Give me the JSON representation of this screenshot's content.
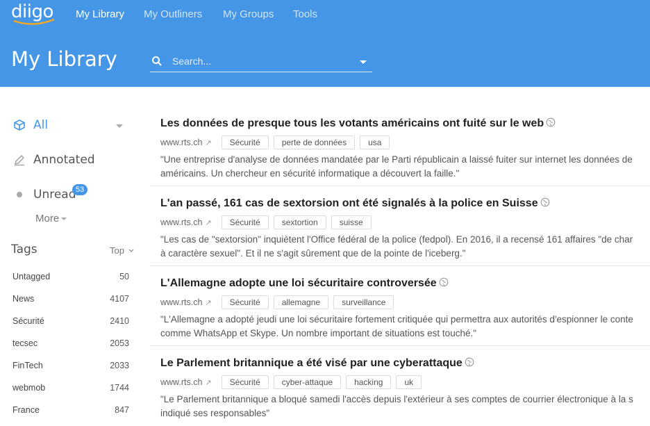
{
  "app": {
    "logo": "diigo",
    "brand_color": "#4596e6"
  },
  "nav": {
    "items": [
      "My Library",
      "My Outliners",
      "My Groups",
      "Tools"
    ],
    "active": "My Library"
  },
  "header": {
    "title": "My Library",
    "search_placeholder": "Search..."
  },
  "sidebar": {
    "filters": [
      {
        "label": "All",
        "icon": "cube-icon",
        "active": true
      },
      {
        "label": "Annotated",
        "icon": "pencil-icon"
      },
      {
        "label": "Unread",
        "icon": "dot-icon",
        "badge": "53"
      }
    ],
    "more_label": "More",
    "tags_heading": "Tags",
    "tags_sort": "Top",
    "tags": [
      {
        "name": "Untagged",
        "count": "50"
      },
      {
        "name": "News",
        "count": "4107"
      },
      {
        "name": "Sécurité",
        "count": "2410"
      },
      {
        "name": "tecsec",
        "count": "2053"
      },
      {
        "name": "FinTech",
        "count": "2033"
      },
      {
        "name": "webmob",
        "count": "1744"
      },
      {
        "name": "France",
        "count": "847"
      }
    ]
  },
  "items": [
    {
      "title": "Les données de presque tous les votants américains ont fuité sur le web",
      "domain": "www.rts.ch",
      "tags": [
        "Sécurité",
        "perte de données",
        "usa"
      ],
      "desc1": "\"Une entreprise d'analyse de données mandatée par le Parti républicain a laissé fuiter sur internet les données de",
      "desc2": "américains. Un chercheur en sécurité informatique a découvert la faille.\""
    },
    {
      "title": "L'an passé, 161 cas de sextorsion ont été signalés à la police en Suisse",
      "domain": "www.rts.ch",
      "tags": [
        "Sécurité",
        "sextortion",
        "suisse"
      ],
      "desc1": "\"Les cas de \"sextorsion\" inquiètent l'Office fédéral de la police (fedpol). En 2016, il a recensé 161 affaires \"de char",
      "desc2": "à caractère sexuel\". Et il ne s'agit sûrement que de la pointe de l'iceberg.\""
    },
    {
      "title": "L'Allemagne adopte une loi sécuritaire controversée",
      "domain": "www.rts.ch",
      "tags": [
        "Sécurité",
        "allemagne",
        "surveillance"
      ],
      "desc1": "\"L'Allemagne a adopté jeudi une loi sécuritaire fortement critiquée qui permettra aux autorités d'espionner le conte",
      "desc2": "comme WhatsApp et Skype. Un nombre important de situations est touché.\""
    },
    {
      "title": "Le Parlement britannique a été visé par une cyberattaque",
      "domain": "www.rts.ch",
      "tags": [
        "Sécurité",
        "cyber-attaque",
        "hacking",
        "uk"
      ],
      "desc1": "\"Le Parlement britannique a bloqué samedi l'accès depuis l'extérieur à ses comptes de courrier électronique à la s",
      "desc2": "indiqué ses responsables\""
    }
  ]
}
